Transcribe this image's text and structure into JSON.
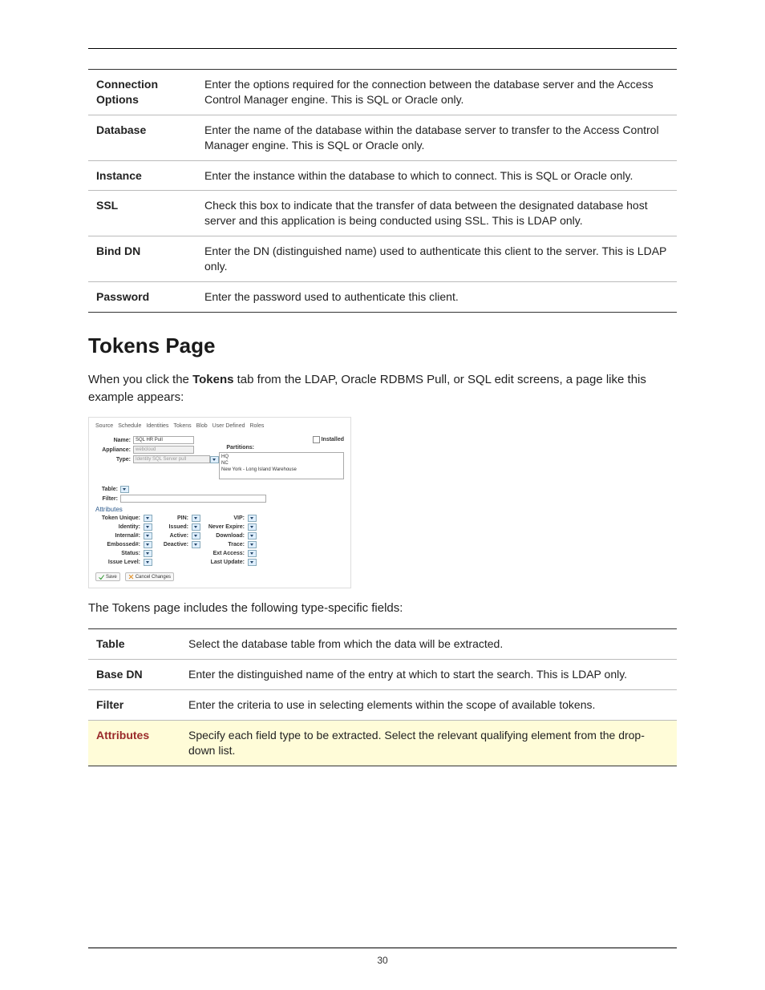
{
  "table1": [
    {
      "k": "Connection Options",
      "v": "Enter the options required for the connection between the database server and the Access Control Manager engine. This is SQL or Oracle only."
    },
    {
      "k": "Database",
      "v": "Enter the name of the database within the database server to transfer to the Access Control Manager engine. This is SQL or Oracle only."
    },
    {
      "k": "Instance",
      "v": "Enter the instance within the database to which to connect. This is SQL or Oracle only."
    },
    {
      "k": "SSL",
      "v": "Check this box to indicate that the transfer of data between the designated database host server and this application is being conducted using SSL. This is LDAP only."
    },
    {
      "k": "Bind DN",
      "v": "Enter the DN (distinguished name) used to authenticate this client to the server. This is LDAP only."
    },
    {
      "k": "Password",
      "v": "Enter the password used to authenticate this client."
    }
  ],
  "heading": "Tokens Page",
  "intro_a": "When you click the ",
  "intro_bold": "Tokens",
  "intro_b": " tab from the LDAP, Oracle RDBMS Pull, or SQL edit screens, a page like this example appears:",
  "fig": {
    "tabs": [
      "Source",
      "Schedule",
      "Identities",
      "Tokens",
      "Blob",
      "User Defined",
      "Roles"
    ],
    "name_label": "Name:",
    "name_value": "SQL HR Pull",
    "appliance_label": "Appliance:",
    "appliance_value": "webcloud",
    "type_label": "Type:",
    "type_value": "Identity SQL Server pull",
    "installed_label": "Installed",
    "partitions_label": "Partitions:",
    "partitions_items": [
      "HQ",
      "NC",
      "New York - Long Island Warehouse"
    ],
    "table_label": "Table:",
    "filter_label": "Filter:",
    "attributes_label": "Attributes",
    "attrs": [
      [
        "Token Unique:",
        "PIN:",
        "VIP:"
      ],
      [
        "Identity:",
        "Issued:",
        "Never Expire:"
      ],
      [
        "Internal#:",
        "Active:",
        "Download:"
      ],
      [
        "Embossed#:",
        "Deactive:",
        "Trace:"
      ],
      [
        "Status:",
        "",
        "Ext Access:"
      ],
      [
        "Issue Level:",
        "",
        "Last Update:"
      ]
    ],
    "save": "Save",
    "cancel": "Cancel Changes"
  },
  "after_fig": "The Tokens page includes the following type-specific fields:",
  "table2": [
    {
      "k": "Table",
      "v": "Select the database table from which the data will be extracted.",
      "hl": false
    },
    {
      "k": "Base DN",
      "v": "Enter the distinguished name of the entry at which to start the search. This is LDAP only.",
      "hl": false
    },
    {
      "k": "Filter",
      "v": "Enter the criteria to use in selecting elements within the scope of available tokens.",
      "hl": false
    },
    {
      "k": "Attributes",
      "v": "Specify each field type to be extracted. Select the relevant qualifying element from the drop-down list.",
      "hl": true
    }
  ],
  "page_number": "30"
}
